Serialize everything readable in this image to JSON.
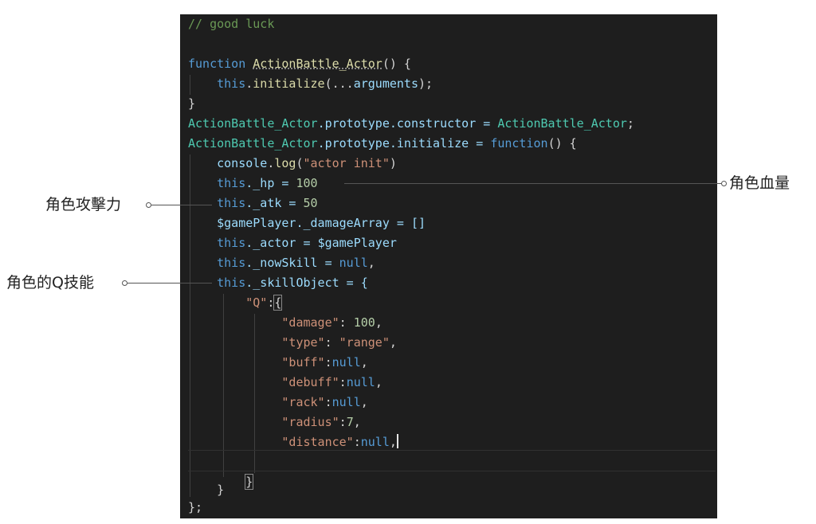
{
  "code": {
    "l1_comment": "// good luck",
    "l3_kw": "function",
    "l3_name": "ActionBattle_Actor",
    "l3_rest": "() {",
    "l4_this": "this",
    "l4_dot": ".",
    "l4_init": "initialize",
    "l4_open": "(...",
    "l4_args": "arguments",
    "l4_close": ");",
    "l5": "}",
    "l6_a": "ActionBattle_Actor",
    "l6_b": ".prototype.constructor = ",
    "l6_c": "ActionBattle_Actor",
    "l6_d": ";",
    "l7_a": "ActionBattle_Actor",
    "l7_b": ".prototype.initialize = ",
    "l7_c": "function",
    "l7_d": "() {",
    "l8_a": "console",
    "l8_b": ".",
    "l8_c": "log",
    "l8_d": "(",
    "l8_e": "\"actor init\"",
    "l8_f": ")",
    "l9_a": "this",
    "l9_b": "._hp = ",
    "l9_c": "100",
    "l10_a": "this",
    "l10_b": "._atk = ",
    "l10_c": "50",
    "l11_a": "$gamePlayer",
    "l11_b": "._damageArray = []",
    "l12_a": "this",
    "l12_b": "._actor = ",
    "l12_c": "$gamePlayer",
    "l13_a": "this",
    "l13_b": "._nowSkill = ",
    "l13_c": "null",
    "l13_d": ",",
    "l14_a": "this",
    "l14_b": "._skillObject = {",
    "l15_a": "\"Q\"",
    "l15_b": ":",
    "l15_c": "{",
    "l16_k": "\"damage\"",
    "l16_s": ": ",
    "l16_v": "100",
    "l16_e": ",",
    "l17_k": "\"type\"",
    "l17_s": ": ",
    "l17_v": "\"range\"",
    "l17_e": ",",
    "l18_k": "\"buff\"",
    "l18_s": ":",
    "l18_v": "null",
    "l18_e": ",",
    "l19_k": "\"debuff\"",
    "l19_s": ":",
    "l19_v": "null",
    "l19_e": ",",
    "l20_k": "\"rack\"",
    "l20_s": ":",
    "l20_v": "null",
    "l20_e": ",",
    "l21_k": "\"radius\"",
    "l21_s": ":",
    "l21_v": "7",
    "l21_e": ",",
    "l22_k": "\"distance\"",
    "l22_s": ":",
    "l22_v": "null",
    "l22_e": ",",
    "l24": "}",
    "l25": "}",
    "l26": "};"
  },
  "annotations": {
    "hp": "角色血量",
    "atk": "角色攻擊力",
    "skill": "角色的Q技能"
  },
  "colors": {
    "editor_bg": "#1e1e1e",
    "keyword": "#569cd6",
    "function": "#dcdcaa",
    "class": "#4ec9b0",
    "string": "#ce9178",
    "number": "#b5cea8",
    "variable": "#9cdcfe",
    "comment": "#6a9955"
  }
}
